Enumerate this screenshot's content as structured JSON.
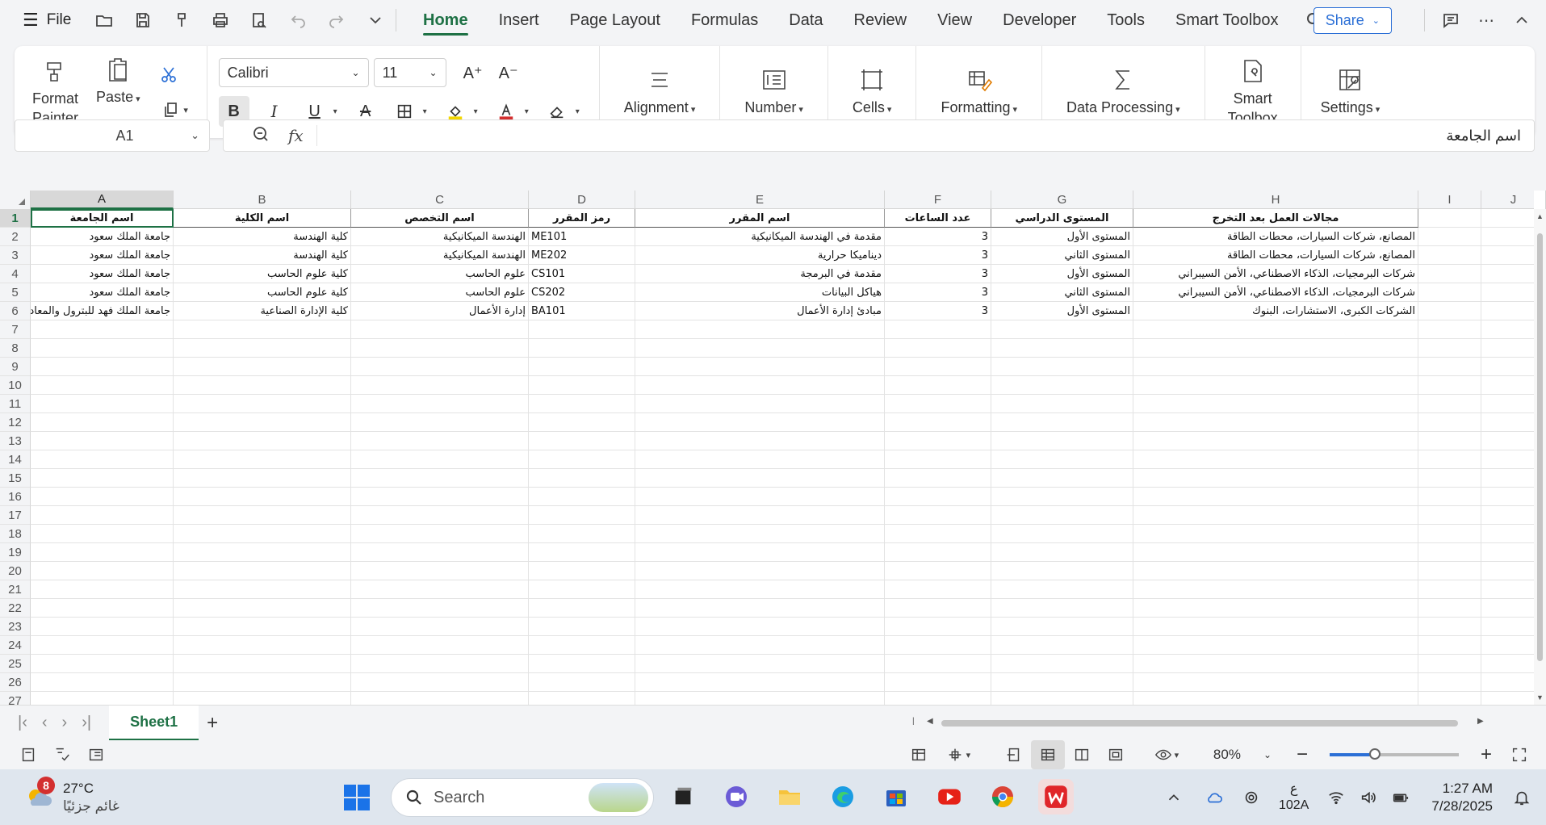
{
  "menubar": {
    "file_label": "File",
    "tabs": [
      "Home",
      "Insert",
      "Page Layout",
      "Formulas",
      "Data",
      "Review",
      "View",
      "Developer",
      "Tools",
      "Smart Toolbox"
    ],
    "active_tab": "Home",
    "share_label": "Share",
    "accent_color": "#1e7145"
  },
  "ribbon": {
    "format_painter_label": "Format\nPainter",
    "paste_label": "Paste",
    "font_name": "Calibri",
    "font_size": "11",
    "alignment_label": "Alignment",
    "number_label": "Number",
    "cells_label": "Cells",
    "formatting_label": "Formatting",
    "data_processing_label": "Data Processing",
    "smart_toolbox_label": "Smart\nToolbox",
    "settings_label": "Settings"
  },
  "formula_bar": {
    "name_box": "A1",
    "fx_label": "fx",
    "content": "اسم الجامعة"
  },
  "grid": {
    "columns": [
      "A",
      "B",
      "C",
      "D",
      "E",
      "F",
      "G",
      "H",
      "I",
      "J"
    ],
    "selected_column": "A",
    "row_numbers": [
      "1",
      "2",
      "3",
      "4",
      "5",
      "6",
      "7",
      "8",
      "9",
      "10",
      "11",
      "12",
      "13",
      "14",
      "15",
      "16",
      "17",
      "18",
      "19",
      "20",
      "21",
      "22",
      "23",
      "24",
      "25",
      "26",
      "27"
    ],
    "header_row": [
      "اسم الجامعة",
      "اسم الكلية",
      "اسم التخصص",
      "رمز المقرر",
      "اسم المقرر",
      "عدد الساعات",
      "المستوى الدراسي",
      "مجالات العمل بعد التخرج"
    ],
    "rows": [
      [
        "جامعة الملك سعود",
        "كلية الهندسة",
        "الهندسة الميكانيكية",
        "ME101",
        "مقدمة في الهندسة الميكانيكية",
        "3",
        "المستوى الأول",
        "المصانع، شركات السيارات، محطات الطاقة"
      ],
      [
        "جامعة الملك سعود",
        "كلية الهندسة",
        "الهندسة الميكانيكية",
        "ME202",
        "ديناميكا حرارية",
        "3",
        "المستوى الثاني",
        "المصانع، شركات السيارات، محطات الطاقة"
      ],
      [
        "جامعة الملك سعود",
        "كلية علوم الحاسب",
        "علوم الحاسب",
        "CS101",
        "مقدمة في البرمجة",
        "3",
        "المستوى الأول",
        "شركات البرمجيات، الذكاء الاصطناعي، الأمن السيبراني"
      ],
      [
        "جامعة الملك سعود",
        "كلية علوم الحاسب",
        "علوم الحاسب",
        "CS202",
        "هياكل البيانات",
        "3",
        "المستوى الثاني",
        "شركات البرمجيات، الذكاء الاصطناعي، الأمن السيبراني"
      ],
      [
        "جامعة الملك فهد للبترول والمعادن",
        "كلية الإدارة الصناعية",
        "إدارة الأعمال",
        "BA101",
        "مبادئ إدارة الأعمال",
        "3",
        "المستوى الأول",
        "الشركات الكبرى، الاستشارات، البنوك"
      ]
    ]
  },
  "sheet_tabs": {
    "active_sheet": "Sheet1",
    "add_label": "+"
  },
  "status_bar": {
    "zoom": "80%",
    "zoom_fraction": 0.35
  },
  "taskbar": {
    "weather_temp": "27°C",
    "weather_desc": "غائم جزئيًا",
    "weather_badge": "8",
    "search_placeholder": "Search",
    "lang_top": "ع",
    "lang_bottom": "102A",
    "time": "1:27 AM",
    "date": "7/28/2025"
  }
}
